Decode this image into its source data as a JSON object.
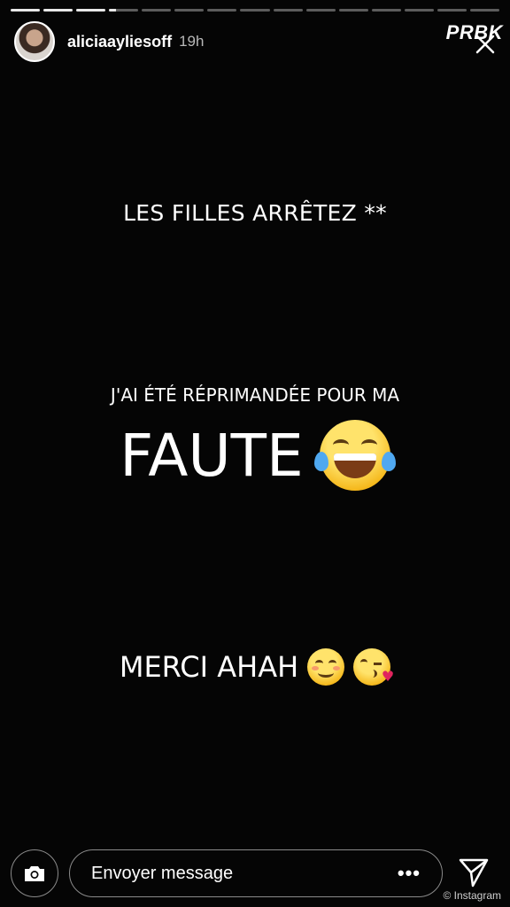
{
  "story": {
    "segments_total": 15,
    "segments_viewed": 3,
    "current_segment_progress": 0.25,
    "username": "aliciaayliesoff",
    "time": "19h"
  },
  "watermark": "PRBK",
  "content": {
    "line1": "LES FILLES ARRÊTEZ **",
    "line2": "J'AI ÉTÉ RÉPRIMANDÉE POUR MA",
    "line3": "FAUTE",
    "line4": "MERCI AHAH"
  },
  "bottom_bar": {
    "message_placeholder": "Envoyer message",
    "more_glyph": "•••"
  },
  "credit": "© Instagram",
  "icons": {
    "camera": "camera-icon",
    "send": "send-icon",
    "close": "close-icon",
    "emoji_1": "face-with-tears-of-joy",
    "emoji_2": "smiling-face",
    "emoji_3": "face-blowing-kiss"
  }
}
